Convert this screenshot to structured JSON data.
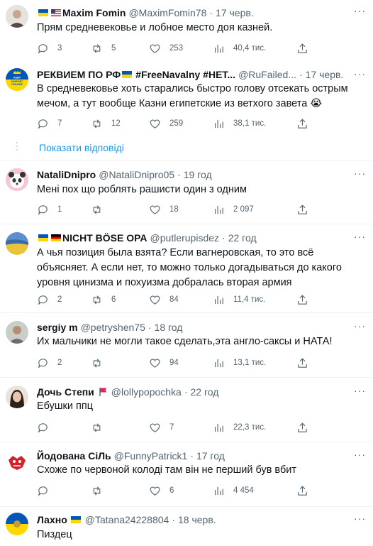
{
  "tweets": [
    {
      "name": "Maxim Fomin",
      "handle": "@MaximFomin78",
      "time": "17 черв.",
      "text": "Прям средневековье и лобное место доя казней.",
      "replies": "3",
      "retweets": "5",
      "likes": "253",
      "views": "40,4 тис."
    },
    {
      "name": "РЕКВИЕМ ПО РФ",
      "name_suffix": "#FreeNavalny #НЕТ...",
      "handle": "@RuFailed...",
      "time": "17 черв.",
      "text": "В средневековье хоть старались быстро голову отсекать острым мечом, а тут вообще Казни египетские из ветхого завета 😭",
      "replies": "7",
      "retweets": "12",
      "likes": "259",
      "views": "38,1 тис.",
      "avatar_text": [
        "KEEP",
        "CALM",
        "and",
        "SUPPORT",
        "UKRAINE"
      ]
    },
    {
      "name": "NataliDnipro",
      "handle": "@NataliDnipro05",
      "time": "19 год",
      "text": "Мені пох що роблять рашисти один з одним",
      "replies": "1",
      "retweets": "",
      "likes": "18",
      "views": "2 097"
    },
    {
      "name": "NICHT BÖSE OPA",
      "handle": "@putlerupisdez",
      "time": "22 год",
      "text": "А чья позиция была взята? Если вагнеровская, то это всё объясняет. А если нет, то можно только догадываться до какого уровня цинизма и похуизма добралась вторая армия",
      "replies": "2",
      "retweets": "6",
      "likes": "84",
      "views": "11,4 тис."
    },
    {
      "name": "sergiy m",
      "handle": "@petryshen75",
      "time": "18 год",
      "text": "Их мальчики не могли такое сделать,эта англо-саксы и НАТА!",
      "replies": "2",
      "retweets": "",
      "likes": "94",
      "views": "13,1 тис."
    },
    {
      "name": "Дочь Степи",
      "handle": "@lollypopochka",
      "time": "22 год",
      "text": "Ебушки ппц",
      "replies": "",
      "retweets": "",
      "likes": "7",
      "views": "22,3 тис."
    },
    {
      "name": "Йодована СіЛь",
      "handle": "@FunnyPatrick1",
      "time": "17 год",
      "text": "Схоже по червоной колоді там він не перший був вбит",
      "replies": "",
      "retweets": "",
      "likes": "6",
      "views": "4 454"
    },
    {
      "name": "Лахно",
      "handle": "@Tatana24228804",
      "time": "18 черв.",
      "text": "Пиздец"
    }
  ],
  "show_replies_label": "Показати відповіді",
  "more_label": "···",
  "dot": "·",
  "icons": [
    "reply-icon",
    "retweet-icon",
    "like-icon",
    "views-icon",
    "share-icon"
  ],
  "colors": {
    "link": "#1d9bf0",
    "muted": "#536471",
    "flag_blue": "#0057b7",
    "flag_yellow": "#ffd700"
  }
}
